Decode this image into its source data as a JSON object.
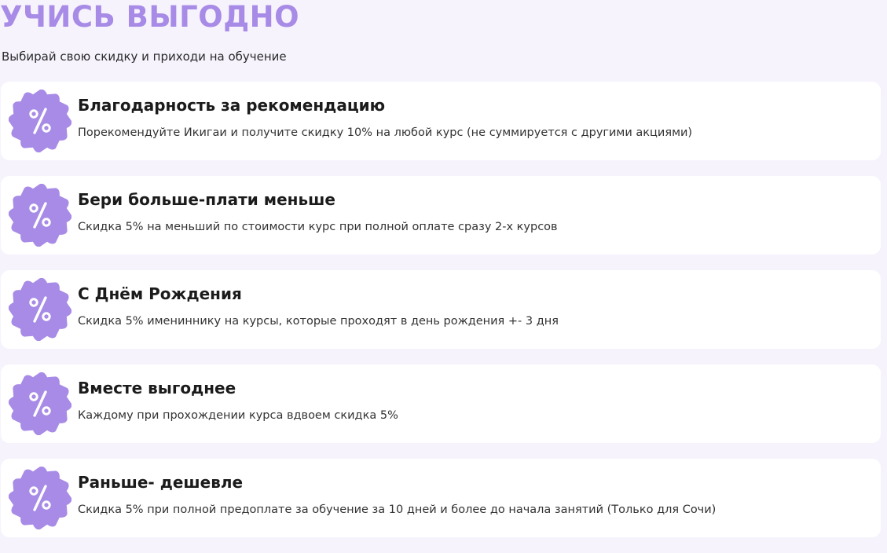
{
  "header": {
    "title": "УЧИСЬ ВЫГОДНО",
    "subtitle": "Выбирай свою скидку и приходи на обучение"
  },
  "colors": {
    "accent": "#a78be6",
    "background": "#f6f3fd",
    "card": "#ffffff"
  },
  "offers": [
    {
      "icon": "percent-badge-icon",
      "title": "Благодарность за рекомендацию",
      "description": "Порекомендуйте Икигаи и получите скидку 10% на любой курс (не суммируется с другими акциями)"
    },
    {
      "icon": "percent-badge-icon",
      "title": "Бери больше-плати меньше",
      "description": "Скидка 5% на меньший по стоимости курс при полной оплате сразу 2-х курсов"
    },
    {
      "icon": "percent-badge-icon",
      "title": "С Днём Рождения",
      "description": "Скидка 5% имениннику на курсы, которые проходят в день рождения +- 3 дня"
    },
    {
      "icon": "percent-badge-icon",
      "title": "Вместе выгоднее",
      "description": "Каждому при прохождении курса вдвоем скидка 5%"
    },
    {
      "icon": "percent-badge-icon",
      "title": "Раньше- дешевле",
      "description": "Скидка 5% при полной предоплате за обучение за 10 дней и более до начала занятий (Только для Сочи)"
    }
  ]
}
